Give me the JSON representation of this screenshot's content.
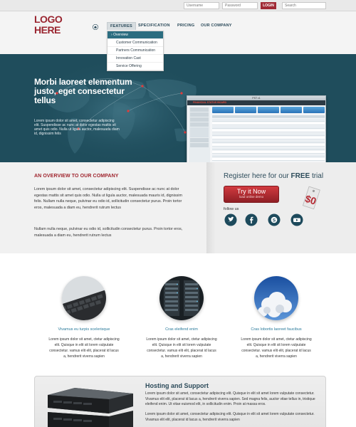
{
  "topbar": {
    "username_placeholder": "Username",
    "password_placeholder": "Password",
    "login_label": "LOGIN",
    "search_placeholder": "Search"
  },
  "logo": {
    "line1": "LOGO",
    "line2": "HERE"
  },
  "nav": {
    "items": [
      "FEATURES",
      "SPECIFICATION",
      "PRICING",
      "OUR COMPANY"
    ]
  },
  "dropdown": {
    "items": [
      "Overview",
      "Customer Communication",
      "Partners Communication",
      "Innovation Cast",
      "Service Offering"
    ]
  },
  "hero": {
    "title": "Morbi laoreet elementum justo, eget consectetur tellus",
    "text": "Lorem ipsum dolor sit amet, consectetur adipiscing elit. Suspendisse ac nunc at dolor egestas mattis sit amet quis odio. Nulla ut ligula auctor, malesuada diam id, dignissim felis",
    "dashboard_title": "PST v1",
    "dashboard_header": "FINANCIAL STATUS BOARD"
  },
  "overview": {
    "title": "AN OVERVIEW TO OUR COMPANY",
    "p1": "Lorem ipsum dolor sit amet, consectetur adipiscing elit. Suspendisse ac nunc at dolor egestas mattis sit amet quis odio. Nulla ut ligula auctor, malesuada mauris id, dignissim felis. Nullam nulla neque, pulvinar eu odio id, sollicitudin consectetur purus. Proin tortor eros, malesuada a diam eu, hendrerit rutrum lectus",
    "p2": "Nullam nulla neque, pulvinar eu odio id, sollicitudin consectetur purus. Proin tortor eros, malesuada a diam eu, hendrerit rutrum lectus"
  },
  "register": {
    "title_prefix": "Register here for our ",
    "title_free": "FREE",
    "title_suffix": " trial",
    "button_main": "Try it Now",
    "button_sub": "load online demo",
    "price": "$0",
    "follow_label": "follow us"
  },
  "features": [
    {
      "title": "Vivamus eu turpis scelerisque",
      "text": "Lorem ipsum dolor sit amet, ctetur adipiscing elit. Quisque in elit sit lorem vulputate consectetur. vamus elit elit, placerat id lacus a, hendrerit viverra sapien"
    },
    {
      "title": "Cras eleifend enim",
      "text": "Lorem ipsum dolor sit amet, ctetur adipiscing elit. Quisque in elit sit lorem vulputate consectetur. vamus elit elit, placerat id lacus a, hendrerit viverra sapien"
    },
    {
      "title": "Cras lobortis laoreet faucibus",
      "text": "Lorem ipsum dolor sit amet, ctetur adipiscing elit. Quisque in elit sit lorem vulputate consectetur. vamus elit elit, placerat id lacus a, hendrerit viverra sapien"
    }
  ],
  "hosting": {
    "title": "Hosting and Support",
    "p1": "Lorem ipsum dolor sit amet, consectetur adipiscing elit. Quisque in elit sit amet lorem vulputate consectetur. Vivamus elit elit, placerat id lacus a, hendrerit viverra sapien. Sed magna felis, auctor vitae tellus in, tristique eleifend enim. Ut vitae euismod elit, in sollicitudin enim. Proin at massa eros.",
    "p2": "Lorem ipsum dolor sit amet, consectetur adipiscing elit. Quisque in elit sit amet lorem vulputate consectetur. Vivamus elit elit, placerat id lacus a, hendrerit viverra sapien"
  },
  "colors": {
    "brand_red": "#9a2530",
    "hero_teal": "#1f4d5c",
    "accent_blue": "#2a7a9a"
  }
}
